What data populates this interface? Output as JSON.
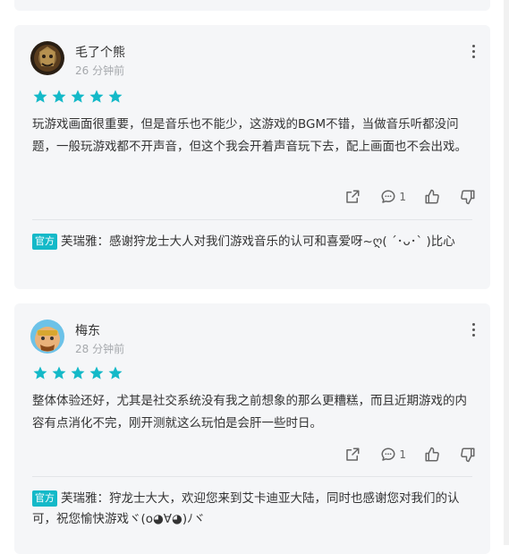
{
  "colors": {
    "accent": "#14b9c8",
    "card_bg": "#f5f6f8",
    "muted": "#a6a9ad"
  },
  "reviews": [
    {
      "username": "毛了个熊",
      "time": "26 分钟前",
      "rating": 5,
      "text": "玩游戏画面很重要，但是音乐也不能少，这游戏的BGM不错，当做音乐听都没问题，一般玩游戏都不开声音，但这个我会开着声音玩下去，配上画面也不会出戏。",
      "comment_count": "1",
      "reply": {
        "badge": "官方",
        "author": "芙瑞雅：",
        "text": "感谢狩龙士大人对我们游戏音乐的认可和喜爱呀~ღ( ´･ᴗ･` )比心"
      }
    },
    {
      "username": "梅东",
      "time": "28 分钟前",
      "rating": 5,
      "text": "整体体验还好，尤其是社交系统没有我之前想象的那么更糟糕，而且近期游戏的内容有点消化不完，刚开测就这么玩怕是会肝一些时日。",
      "comment_count": "1",
      "reply": {
        "badge": "官方",
        "author": "芙瑞雅：",
        "text": "狩龙士大大，欢迎您来到艾卡迪亚大陆，同时也感谢您对我们的认可，祝您愉快游戏ヾ(o◕∀◕)ﾉヾ"
      }
    }
  ]
}
